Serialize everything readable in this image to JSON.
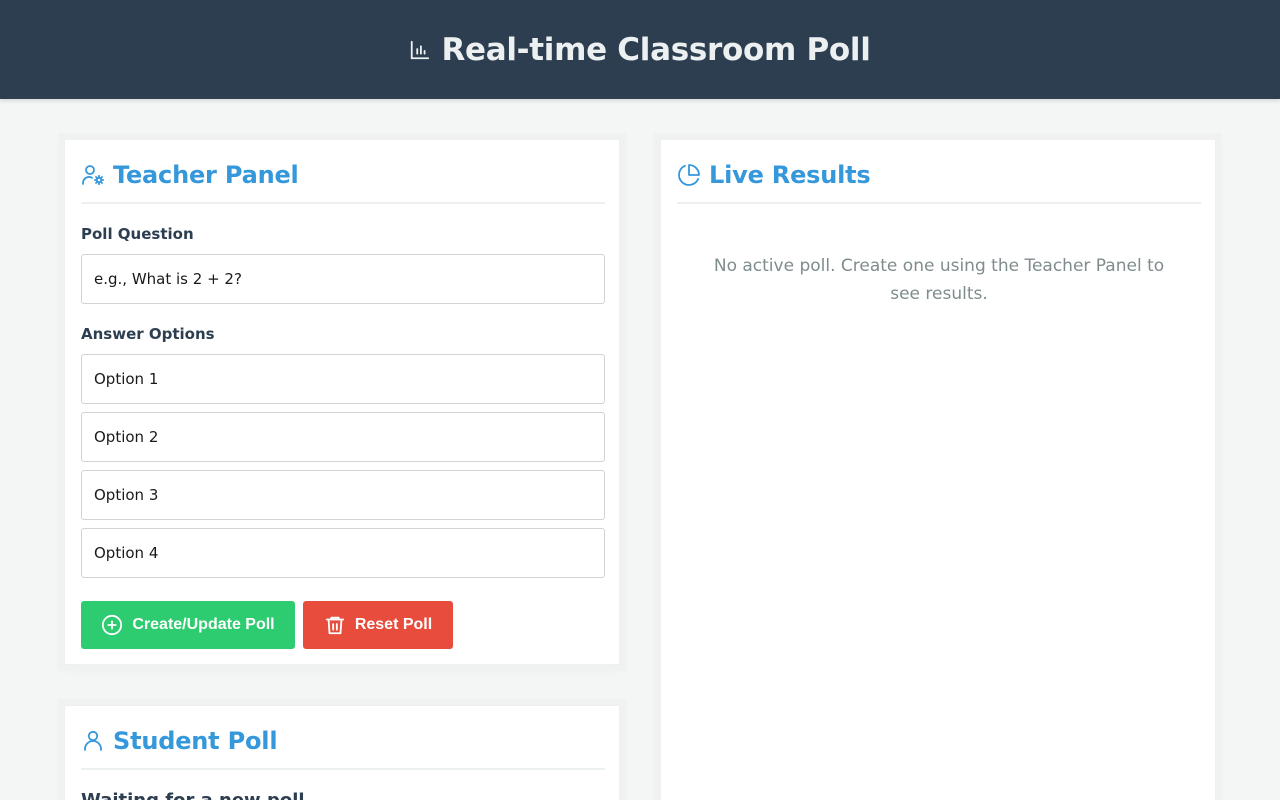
{
  "header": {
    "title": "Real-time Classroom Poll",
    "icon": "bar-chart-icon"
  },
  "teacher_panel": {
    "title": "Teacher Panel",
    "icon": "user-cog-icon",
    "question_label": "Poll Question",
    "question_placeholder": "e.g., What is 2 + 2?",
    "question_value": "",
    "options_label": "Answer Options",
    "options": [
      {
        "placeholder": "Option 1",
        "value": ""
      },
      {
        "placeholder": "Option 2",
        "value": ""
      },
      {
        "placeholder": "Option 3",
        "value": ""
      },
      {
        "placeholder": "Option 4",
        "value": ""
      }
    ],
    "create_button": "Create/Update Poll",
    "reset_button": "Reset Poll"
  },
  "results_panel": {
    "title": "Live Results",
    "icon": "pie-chart-icon",
    "empty_message": "No active poll. Create one using the Teacher Panel to see results."
  },
  "student_panel": {
    "title": "Student Poll",
    "icon": "user-icon",
    "status": "Waiting for a new poll..."
  },
  "colors": {
    "header_bg": "#2c3e50",
    "accent": "#3498db",
    "create": "#2ecc71",
    "reset": "#e74c3c",
    "muted": "#7f8c8d",
    "page_bg": "#f4f6f6"
  }
}
